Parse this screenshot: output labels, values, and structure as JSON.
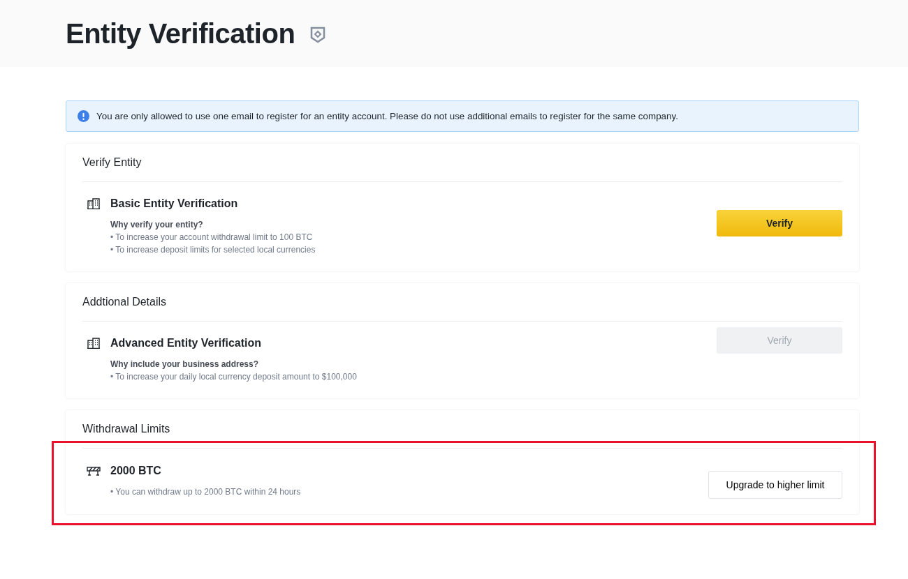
{
  "header": {
    "title": "Entity Verification"
  },
  "notice": {
    "text": "You are only allowed to use one email to register for an entity account. Please do not use additional emails to register for the same company."
  },
  "sections": [
    {
      "title": "Verify Entity",
      "highlighted": false,
      "item": {
        "kind": "verification",
        "name": "Basic Entity Verification",
        "question": "Why verify your entity?",
        "bullets": [
          "• To increase your account withdrawal limit to 100 BTC",
          "• To increase deposit limits for selected local currencies"
        ],
        "button": {
          "label": "Verify",
          "kind": "primary",
          "disabled": false
        }
      }
    },
    {
      "title": "Addtional Details",
      "highlighted": false,
      "item": {
        "kind": "verification",
        "name": "Advanced Entity Verification",
        "question": "Why include your business address?",
        "bullets": [
          "• To increase your daily local currency deposit amount to $100,000"
        ],
        "button": {
          "label": "Verify",
          "kind": "primary",
          "disabled": true
        }
      }
    },
    {
      "title": "Withdrawal Limits",
      "highlighted": true,
      "item": {
        "kind": "limit",
        "name": "2000 BTC",
        "bullets": [
          "• You can withdraw up to 2000 BTC within 24 hours"
        ],
        "button": {
          "label": "Upgrade to higher limit",
          "kind": "outline",
          "disabled": false
        }
      }
    }
  ]
}
